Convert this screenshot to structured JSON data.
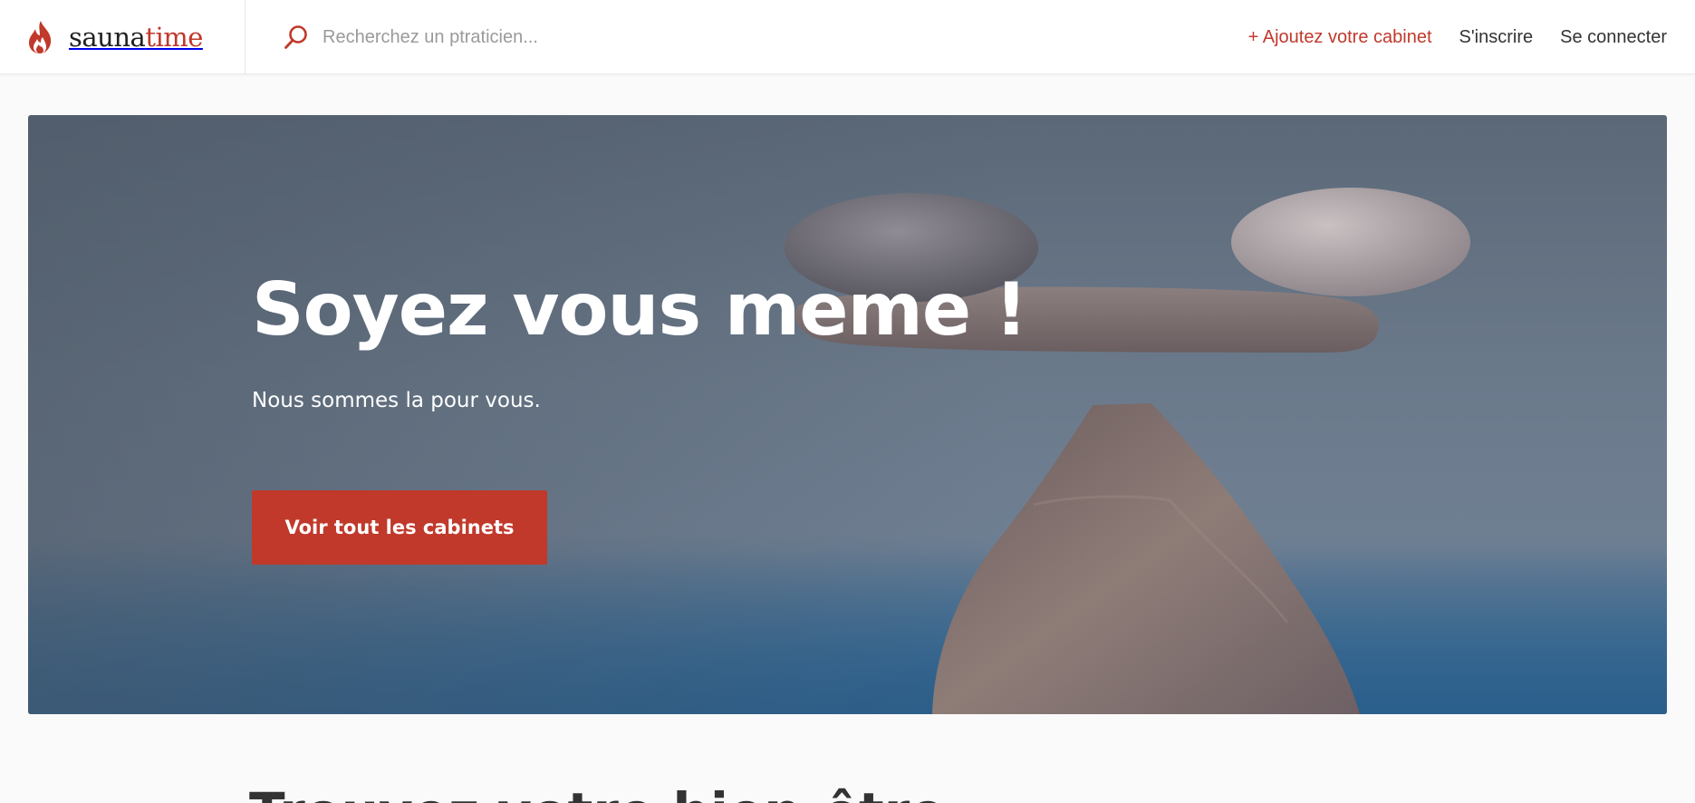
{
  "brand": {
    "name_main": "sauna",
    "name_accent": "time",
    "icon": "flame-icon"
  },
  "search": {
    "placeholder": "Recherchez un ptraticien...",
    "icon": "search-icon"
  },
  "nav": {
    "add_cabinet": "+ Ajoutez votre cabinet",
    "signup": "S'inscrire",
    "login": "Se connecter"
  },
  "hero": {
    "title": "Soyez vous meme !",
    "subtitle": "Nous sommes la pour vous.",
    "cta": "Voir tout les cabinets"
  },
  "section": {
    "title_partial": "Trouvez votre bien-être"
  },
  "colors": {
    "accent": "#c0392b",
    "text": "#333333",
    "background": "#fafafa"
  }
}
